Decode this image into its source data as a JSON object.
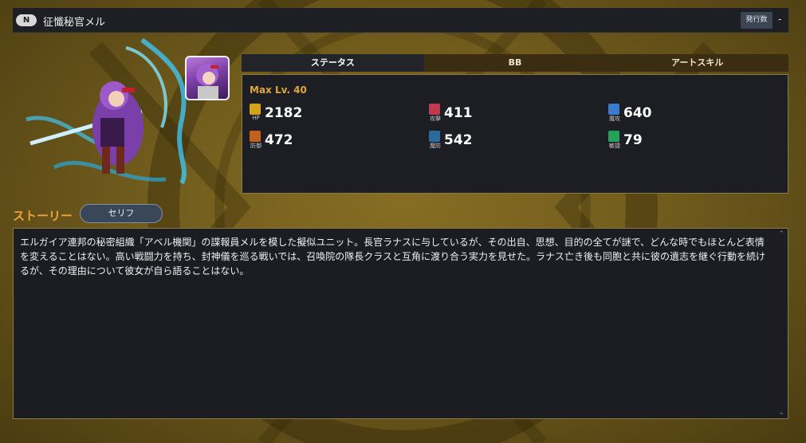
{
  "header": {
    "rarity": "N",
    "unit_name": "征懺秘官メル",
    "issue_label": "発行数",
    "issue_value": "-"
  },
  "tabs": [
    {
      "label": "ステータス",
      "active": true
    },
    {
      "label": "BB",
      "active": false
    },
    {
      "label": "アートスキル",
      "active": false
    }
  ],
  "status": {
    "max_level": "Max Lv. 40",
    "stats": [
      {
        "key": "hp",
        "label": "HP",
        "value": "2182",
        "color": "#d7a21b"
      },
      {
        "key": "atk",
        "label": "攻撃",
        "value": "411",
        "color": "#c03a50"
      },
      {
        "key": "matk",
        "label": "魔攻",
        "value": "640",
        "color": "#3a7bd0"
      },
      {
        "key": "def",
        "label": "防御",
        "value": "472",
        "color": "#c0621d"
      },
      {
        "key": "mdef",
        "label": "魔防",
        "value": "542",
        "color": "#2a6b9b"
      },
      {
        "key": "agi",
        "label": "敏捷",
        "value": "79",
        "color": "#23a25c"
      }
    ]
  },
  "story": {
    "title": "ストーリー",
    "serif_button": "セリフ",
    "text": "エルガイア連邦の秘密組織「アベル機関」の諜報員メルを模した擬似ユニット。長官ラナスに与しているが、その出自、思想、目的の全てが謎で、どんな時でもほとんど表情を変えることはない。高い戦闘力を持ち、封神儀を巡る戦いでは、召喚院の隊長クラスと互角に渡り合う実力を見せた。ラナス亡き後も同胞と共に彼の遺志を継ぐ行動を続けるが、その理由について彼女が自ら語ることはない。"
  },
  "icons": {
    "scroll_up": "chevron-up-icon",
    "scroll_down": "chevron-down-icon"
  }
}
